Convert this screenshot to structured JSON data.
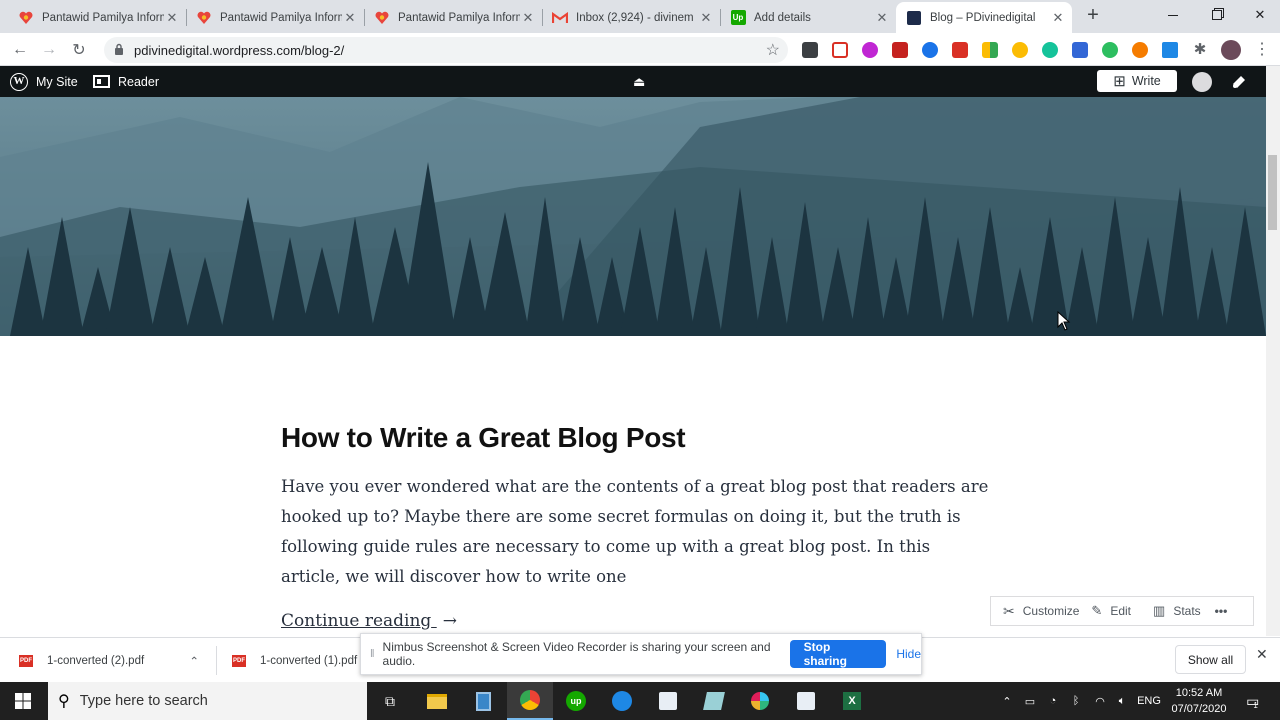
{
  "browser": {
    "tabs": [
      {
        "title": "Pantawid Pamilya Inform",
        "favicon": "pantawid-heart-icon",
        "active": false
      },
      {
        "title": "Pantawid Pamilya Inform",
        "favicon": "pantawid-heart-icon",
        "active": false
      },
      {
        "title": "Pantawid Pamilya Inform",
        "favicon": "pantawid-heart-icon",
        "active": false
      },
      {
        "title": "Inbox (2,924) - divinem",
        "favicon": "gmail-icon",
        "active": false
      },
      {
        "title": "Add details",
        "favicon": "upwork-icon",
        "active": false
      },
      {
        "title": "Blog – PDivinedigital",
        "favicon": "blog-square-icon",
        "active": true
      }
    ],
    "new_tab": "+",
    "url": "pdivinedigital.wordpress.com/blog-2/"
  },
  "wp_admin_bar": {
    "my_site": "My Site",
    "reader": "Reader",
    "write": "Write"
  },
  "post": {
    "title": "How to Write a Great Blog Post",
    "excerpt": "Have you ever wondered what are the contents of a great blog post that readers are hooked up to? Maybe there are some secret formulas on doing it, but the truth is following guide rules are necessary to come up with a great blog post. In this article, we will discover how to write one",
    "continue_reading": "Continue reading",
    "continue_arrow": "→"
  },
  "customize_bar": {
    "customize": "Customize",
    "edit": "Edit",
    "stats": "Stats",
    "more": "•••"
  },
  "downloads": {
    "items": [
      {
        "name": "1-converted (2).pdf",
        "badge": "PDF"
      },
      {
        "name": "1-converted (1).pdf",
        "badge": "PDF"
      }
    ],
    "show_all": "Show all"
  },
  "nimbus": {
    "message": "Nimbus Screenshot & Screen Video Recorder is sharing your screen and audio.",
    "stop": "Stop sharing",
    "hide": "Hide"
  },
  "taskbar": {
    "search_placeholder": "Type here to search",
    "language": "ENG",
    "time": "10:52 AM",
    "date": "07/07/2020",
    "notification_count": "1"
  },
  "colors": {
    "wp_bar": "#101517",
    "stop_button": "#1a73e8",
    "taskbar": "#202020"
  }
}
